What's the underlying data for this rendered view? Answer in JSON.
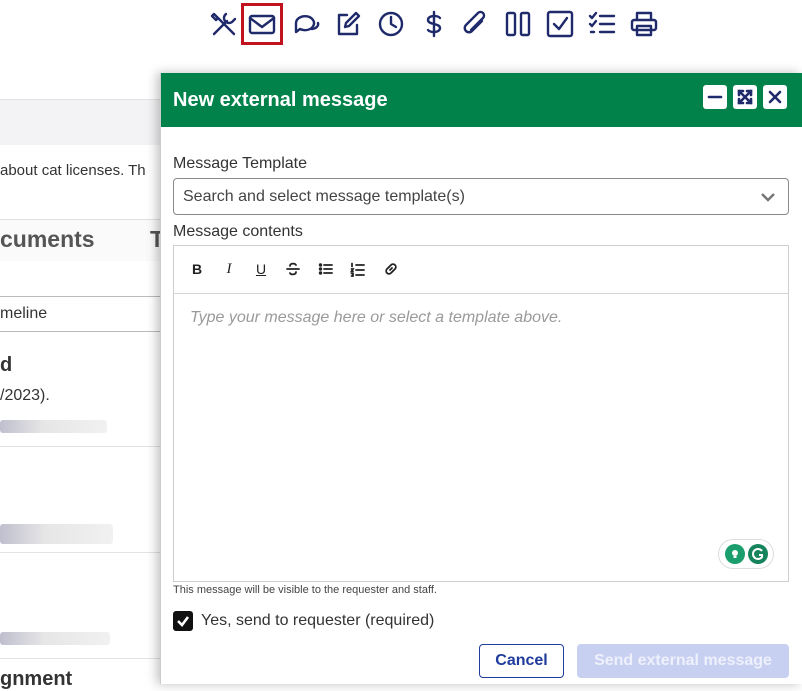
{
  "toolbar": {
    "icons": [
      "tools-icon",
      "envelope-icon",
      "chat-icon",
      "edit-icon",
      "clock-icon",
      "dollar-icon",
      "paperclip-icon",
      "columns-icon",
      "checkbox-icon",
      "checklist-icon",
      "printer-icon"
    ],
    "active": "envelope-icon"
  },
  "background": {
    "snippet": "about cat licenses. Th",
    "tab_documents": "cuments",
    "tab_next": "T",
    "select_value": "meline",
    "heading_fragment": "d",
    "date_fragment": "/2023).",
    "bottom_heading": "gnment"
  },
  "dialog": {
    "title": "New external message",
    "template_label": "Message Template",
    "template_placeholder": "Search and select message template(s)",
    "contents_label": "Message contents",
    "formatting": {
      "bold": "B",
      "italic": "I",
      "underline": "U"
    },
    "editor_placeholder": "Type your message here or select a template above.",
    "visibility_note": "This message will be visible to the requester and staff.",
    "send_checkbox_label": "Yes, send to requester (required)",
    "send_checkbox_checked": true,
    "cancel_label": "Cancel",
    "send_label": "Send external message"
  },
  "colors": {
    "header_green": "#00824a",
    "icon_navy": "#1f2a6b",
    "active_outline": "#c1121f",
    "primary_blue": "#1f3b9c",
    "disabled_button": "#c8d0f2"
  }
}
